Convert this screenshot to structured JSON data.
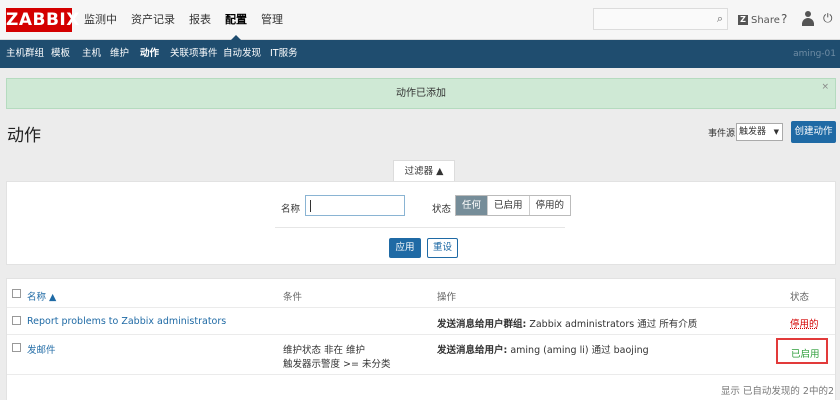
{
  "header": {
    "logo": "ZABBIX",
    "nav": [
      "监测中",
      "资产记录",
      "报表",
      "配置",
      "管理"
    ],
    "active_nav": "配置",
    "share_label": "Share",
    "help_icon": "?",
    "power_icon": "⏻"
  },
  "subnav": {
    "items": [
      "主机群组",
      "模板",
      "主机",
      "维护",
      "动作",
      "关联项事件",
      "自动发现",
      "IT服务"
    ],
    "active": "动作",
    "user": "aming-01"
  },
  "message": {
    "text": "动作已添加",
    "close": "×"
  },
  "page": {
    "title": "动作",
    "event_source_label": "事件源",
    "event_source_value": "触发器",
    "create_button": "创建动作"
  },
  "filter": {
    "tab_label": "过滤器 ▲",
    "name_label": "名称",
    "name_value": "",
    "status_label": "状态",
    "status_options": [
      "任何",
      "已启用",
      "停用的"
    ],
    "status_selected": "任何",
    "apply_button": "应用",
    "reset_button": "重设"
  },
  "table": {
    "columns": [
      "名称 ▲",
      "条件",
      "操作",
      "状态"
    ],
    "rows": [
      {
        "name": "Report problems to Zabbix administrators",
        "conditions": [],
        "op_bold": "发送消息给用户群组:",
        "op_rest": " Zabbix administrators 通过 所有介质",
        "status": "停用的"
      },
      {
        "name": "发邮件",
        "conditions": [
          "维护状态 非在 维护",
          "触发器示警度 >= 未分类"
        ],
        "op_bold": "发送消息给用户:",
        "op_rest": " aming (aming li) 通过 baojing",
        "status": "已启用"
      }
    ],
    "footer": "显示 已自动发现的 2中的2"
  },
  "colors": {
    "brand_red": "#d40000",
    "subnav_bg": "#1f4d6f",
    "primary_blue": "#1f6aa5",
    "success_bg": "#cfe9d5",
    "enabled_green": "#2d9e3a",
    "disabled_red": "#d40000"
  }
}
